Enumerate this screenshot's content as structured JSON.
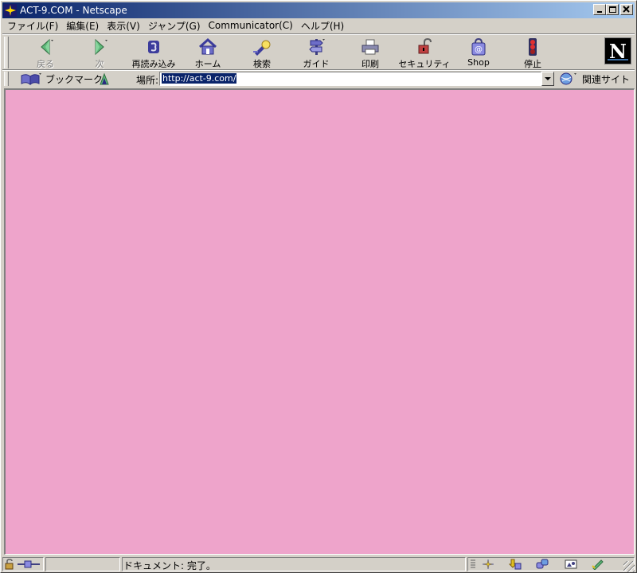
{
  "window": {
    "title": "ACT-9.COM - Netscape"
  },
  "menu": [
    {
      "label": "ファイル(F)",
      "name": "menu-file"
    },
    {
      "label": "編集(E)",
      "name": "menu-edit"
    },
    {
      "label": "表示(V)",
      "name": "menu-view"
    },
    {
      "label": "ジャンプ(G)",
      "name": "menu-go"
    },
    {
      "label": "Communicator(C)",
      "name": "menu-communicator"
    },
    {
      "label": "ヘルプ(H)",
      "name": "menu-help"
    }
  ],
  "toolbar": {
    "back": "戻る",
    "forward": "次",
    "reload": "再読み込み",
    "home": "ホーム",
    "search": "検索",
    "guide": "ガイド",
    "print": "印刷",
    "security": "セキュリティ",
    "shop": "Shop",
    "stop": "停止"
  },
  "logo": "N",
  "location": {
    "bookmarks_label": "ブックマーク",
    "label": "場所:",
    "url": "http://act-9.com/",
    "related_label": "関連サイト"
  },
  "status": {
    "text": "ドキュメント: 完了。"
  },
  "colors": {
    "content_bg": "#eea4cb",
    "titlebar": "#0a246a"
  }
}
